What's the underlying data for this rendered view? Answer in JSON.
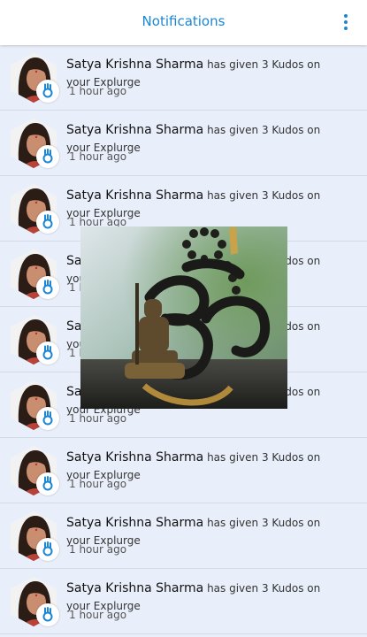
{
  "header": {
    "title": "Notifications",
    "menu_icon": "more-vertical-icon"
  },
  "colors": {
    "accent": "#1a86d4",
    "background": "#e9effa"
  },
  "notifications": [
    {
      "name": "Satya Krishna Sharma",
      "message": "has given 3 Kudos on your Explurge",
      "time": "1 hour ago"
    },
    {
      "name": "Satya Krishna Sharma",
      "message": "has given 3 Kudos on your Explurge",
      "time": "1 hour ago"
    },
    {
      "name": "Satya Krishna Sharma",
      "message": "has given 3 Kudos on your Explurge",
      "time": "1 hour ago"
    },
    {
      "name": "Satya Krishna Sharma",
      "message": "has given 3 Kudos on your Explurge",
      "time": "1 hour ago"
    },
    {
      "name": "Satya Krishna Sharma",
      "message": "has given 3 Kudos on your Explurge",
      "time": "1 hour ago"
    },
    {
      "name": "Satya Krishna Sharma",
      "message": "has given 3 Kudos on your Explurge",
      "time": "1 hour ago"
    },
    {
      "name": "Satya Krishna Sharma",
      "message": "has given 3 Kudos on your Explurge",
      "time": "1 hour ago"
    },
    {
      "name": "Satya Krishna Sharma",
      "message": "has given 3 Kudos on your Explurge",
      "time": "1 hour ago"
    },
    {
      "name": "Satya Krishna Sharma",
      "message": "has given 3 Kudos on your Explurge",
      "time": "1 hour ago"
    }
  ],
  "overlay_image": {
    "subject": "om-symbol-with-shiva-figurine"
  }
}
